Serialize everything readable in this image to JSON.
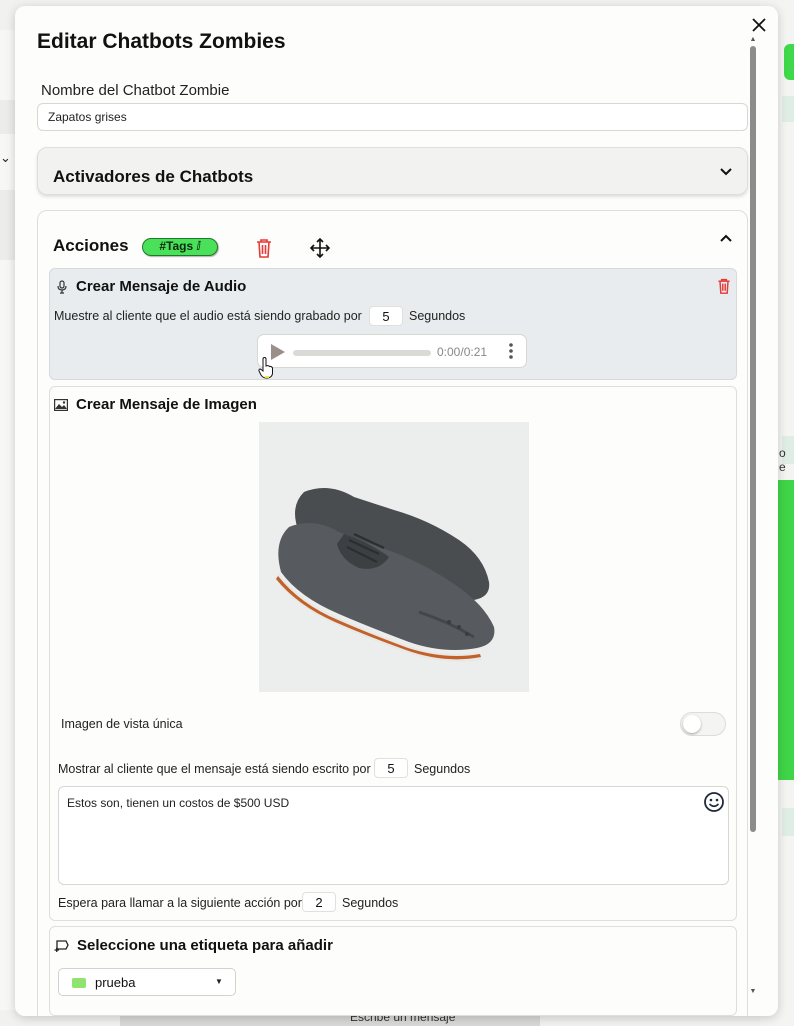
{
  "modal": {
    "title": "Editar Chatbots Zombies",
    "close_icon": "close-icon"
  },
  "name_field": {
    "label": "Nombre del Chatbot Zombie",
    "value": "Zapatos grises"
  },
  "triggers": {
    "title": "Activadores de Chatbots",
    "state": "collapsed"
  },
  "actions": {
    "title": "Acciones",
    "tags_badge": "#Tags",
    "state": "expanded"
  },
  "audio_message": {
    "title": "Crear Mensaje de Audio",
    "recording_text": "Muestre al cliente que el audio está siendo grabado por",
    "recording_seconds": "5",
    "seconds_label": "Segundos",
    "player_time": "0:00/0:21",
    "progress": 0
  },
  "image_message": {
    "title": "Crear Mensaje de Imagen",
    "single_view_label": "Imagen de vista única",
    "single_view_enabled": false,
    "typing_text": "Mostrar al cliente que el mensaje está siendo escrito por",
    "typing_seconds": "5",
    "seconds_label": "Segundos",
    "message": "Estos son, tienen un costos de $500 USD",
    "wait_text": "Espera para llamar a la siguiente acción por",
    "wait_seconds": "2",
    "wait_seconds_label": "Segundos"
  },
  "tag_action": {
    "title": "Seleccione una etiqueta para añadir",
    "selected": "prueba",
    "tag_color": "#8ee46c"
  },
  "background": {
    "peek_text": "o e",
    "taskbar_text": "Escribe un mensaje"
  },
  "colors": {
    "accent_green": "#4be05a",
    "danger_red": "#e53935"
  }
}
